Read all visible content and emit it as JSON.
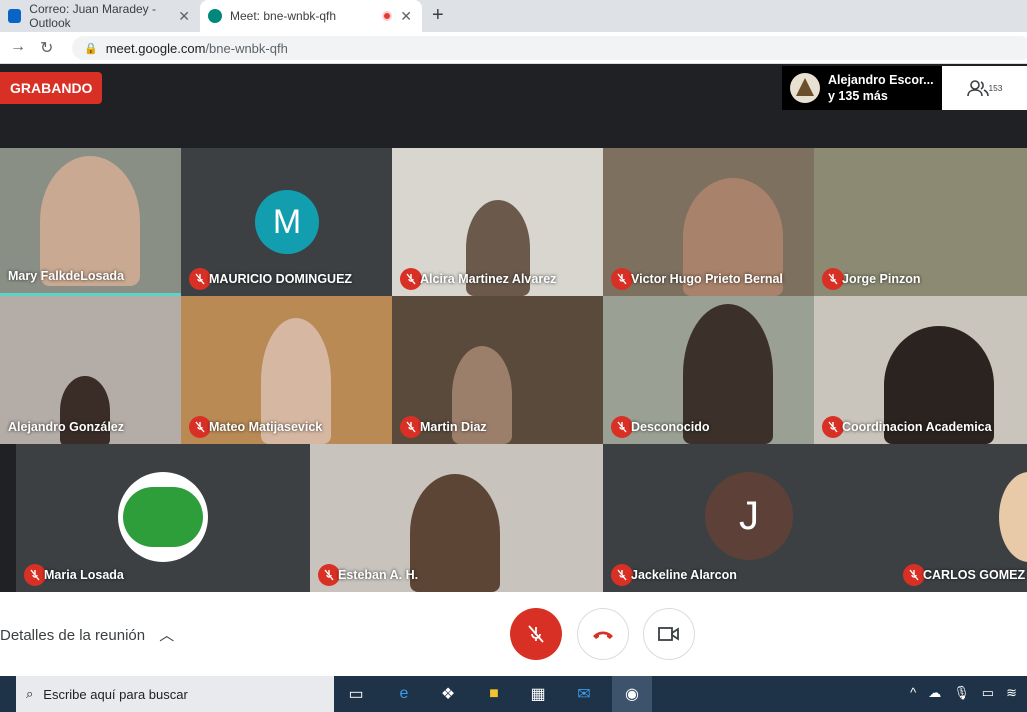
{
  "browser": {
    "tabs": [
      {
        "label": "Correo: Juan Maradey - Outlook",
        "close": "✕"
      },
      {
        "label": "Meet: bne-wnbk-qfh",
        "close": "✕"
      }
    ],
    "new_tab": "+",
    "url_host": "meet.google.com",
    "url_path": "/bne-wnbk-qfh"
  },
  "meet": {
    "recording_label": "GRABANDO",
    "presenter_name": "Alejandro Escor...",
    "presenter_more": "y 135 más",
    "participant_count": "153",
    "participants": [
      {
        "name": "Mary FalkdeLosada"
      },
      {
        "name": "MAURICIO DOMINGUEZ",
        "initial": "M"
      },
      {
        "name": "Alcira Martinez Alvarez"
      },
      {
        "name": "Victor Hugo Prieto Bernal"
      },
      {
        "name": "Jorge Pinzon"
      },
      {
        "name": "Alejandro González"
      },
      {
        "name": "Mateo Matijasevick"
      },
      {
        "name": "Martin Diaz"
      },
      {
        "name": "Desconocido"
      },
      {
        "name": "Coordinacion Academica"
      },
      {
        "name": "Maria Losada"
      },
      {
        "name": "Esteban A. H."
      },
      {
        "name": "Jackeline Alarcon",
        "initial": "J"
      },
      {
        "name": "CARLOS GOMEZ"
      }
    ],
    "details_label": "Detalles de la reunión"
  },
  "taskbar": {
    "search_placeholder": "Escribe aquí para buscar"
  },
  "colors": {
    "recording_red": "#d93025",
    "meet_bg": "#202124",
    "avatar_teal": "#129eaf",
    "avatar_brown": "#5d4037"
  }
}
